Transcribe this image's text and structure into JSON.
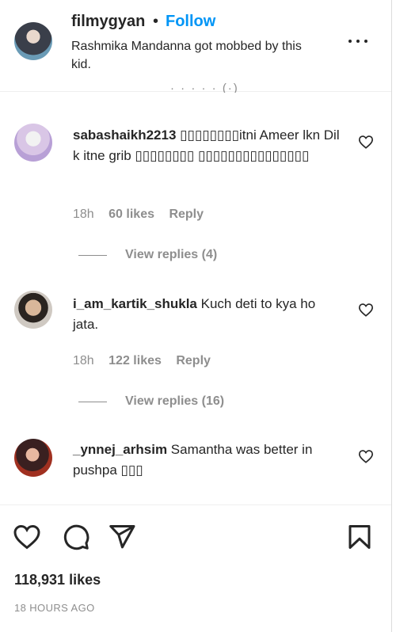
{
  "post": {
    "username": "filmygyan",
    "separator": "•",
    "follow_label": "Follow",
    "caption": "Rashmika Mandanna got mobbed by this kid.",
    "clipped_text": "· · · · · (·)",
    "icon": "more-horizontal-icon"
  },
  "comments": [
    {
      "username": "sabashaikh2213",
      "text": "▯▯▯▯▯▯▯▯itni Ameer lkn Dil k itne grib ▯▯▯▯▯▯▯▯ ▯▯▯▯▯▯▯▯▯▯▯▯▯▯▯",
      "time": "18h",
      "likes": "60 likes",
      "reply": "Reply",
      "view_replies": "View replies (4)"
    },
    {
      "username": "i_am_kartik_shukla",
      "text": "Kuch deti to kya ho jata.",
      "time": "18h",
      "likes": "122 likes",
      "reply": "Reply",
      "view_replies": "View replies (16)"
    },
    {
      "username": "_ynnej_arhsim",
      "text": "Samantha was better in pushpa ▯▯▯"
    }
  ],
  "actions": {
    "like_icon": "heart-icon",
    "comment_icon": "comment-icon",
    "share_icon": "send-icon",
    "save_icon": "bookmark-icon"
  },
  "likes_count": "118,931 likes",
  "time_ago": "18 HOURS AGO",
  "colors": {
    "text": "#262626",
    "muted": "#8e8e8e",
    "link": "#0095f6",
    "border": "#dbdbdb"
  }
}
